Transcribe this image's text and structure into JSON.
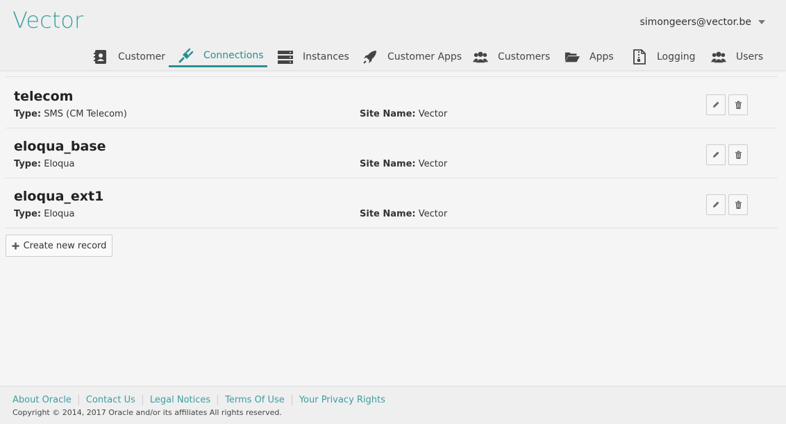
{
  "app": {
    "title": "Vector"
  },
  "user": {
    "email": "simongeers@vector.be"
  },
  "nav": {
    "tabs": [
      {
        "label": "Customer",
        "icon": "address-card-icon"
      },
      {
        "label": "Connections",
        "icon": "plug-icon",
        "active": true
      },
      {
        "label": "Instances",
        "icon": "server-icon"
      },
      {
        "label": "Customer Apps",
        "icon": "rocket-icon"
      },
      {
        "label": "Customers",
        "icon": "users-icon"
      },
      {
        "label": "Apps",
        "icon": "folder-open-icon"
      },
      {
        "label": "Logging",
        "icon": "file-zip-icon"
      },
      {
        "label": "Users",
        "icon": "users-icon"
      }
    ]
  },
  "records": [
    {
      "title": "telecom",
      "type_label": "Type:",
      "type_value": "SMS (CM Telecom)",
      "site_label": "Site Name:",
      "site_value": "Vector"
    },
    {
      "title": "eloqua_base",
      "type_label": "Type:",
      "type_value": "Eloqua",
      "site_label": "Site Name:",
      "site_value": "Vector"
    },
    {
      "title": "eloqua_ext1",
      "type_label": "Type:",
      "type_value": "Eloqua",
      "site_label": "Site Name:",
      "site_value": "Vector"
    }
  ],
  "actions": {
    "create_label": "Create new record"
  },
  "footer": {
    "links": [
      "About Oracle",
      "Contact Us",
      "Legal Notices",
      "Terms Of Use",
      "Your Privacy Rights"
    ],
    "copyright": "Copyright © 2014, 2017 Oracle and/or its affiliates All rights reserved."
  },
  "colors": {
    "accent": "#3a9ea1",
    "active_tab": "#2a8f92"
  }
}
